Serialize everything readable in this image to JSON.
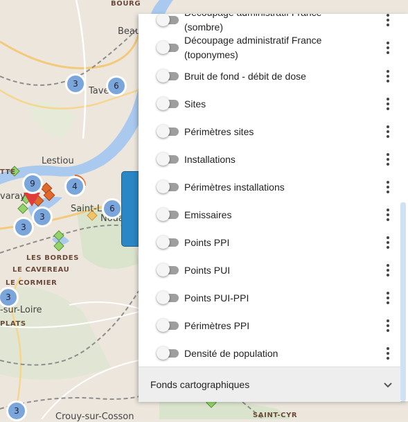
{
  "map": {
    "labels": [
      {
        "id": "bourg",
        "text": "BOURG",
        "cls": "caps"
      },
      {
        "id": "beau",
        "text": "Beau",
        "cls": "town"
      },
      {
        "id": "tave",
        "text": "Tave",
        "cls": "town"
      },
      {
        "id": "lestiou",
        "text": "Lestiou",
        "cls": "town"
      },
      {
        "id": "varay",
        "text": "varay",
        "cls": "town"
      },
      {
        "id": "tte",
        "text": "TTE",
        "cls": "caps"
      },
      {
        "id": "saint-l",
        "text": "Saint-L",
        "cls": "town"
      },
      {
        "id": "nouan",
        "text": "Nouan",
        "cls": "town"
      },
      {
        "id": "les-bordes",
        "text": "LES BORDES",
        "cls": "caps"
      },
      {
        "id": "le-cavereau",
        "text": "LE CAVEREAU",
        "cls": "caps"
      },
      {
        "id": "le-cormier",
        "text": "LE CORMIER",
        "cls": "caps"
      },
      {
        "id": "sur-loire",
        "text": "-sur-Loire",
        "cls": "town"
      },
      {
        "id": "plats",
        "text": "PLATS",
        "cls": "caps"
      },
      {
        "id": "crouy",
        "text": "Crouy-sur-Cosson",
        "cls": "town"
      },
      {
        "id": "saint-cyr",
        "text": "SAINT-CYR",
        "cls": "caps"
      }
    ],
    "clusters": [
      {
        "id": "c1",
        "count": "3"
      },
      {
        "id": "c2",
        "count": "6"
      },
      {
        "id": "c3",
        "count": "9"
      },
      {
        "id": "c4",
        "count": "4"
      },
      {
        "id": "c5",
        "count": "6"
      },
      {
        "id": "c6",
        "count": "3"
      },
      {
        "id": "c7",
        "count": "3"
      },
      {
        "id": "c8",
        "count": "3"
      },
      {
        "id": "c9",
        "count": "3"
      }
    ]
  },
  "layers_panel": {
    "layers": [
      {
        "label": "Découpage administratif France (sombre)",
        "enabled": false
      },
      {
        "label": "Découpage administratif France (toponymes)",
        "enabled": false
      },
      {
        "label": "Bruit de fond - débit de dose",
        "enabled": false
      },
      {
        "label": "Sites",
        "enabled": false
      },
      {
        "label": "Périmètres sites",
        "enabled": false
      },
      {
        "label": "Installations",
        "enabled": false
      },
      {
        "label": "Périmètres installations",
        "enabled": false
      },
      {
        "label": "Emissaires",
        "enabled": false
      },
      {
        "label": "Points PPI",
        "enabled": false
      },
      {
        "label": "Points PUI",
        "enabled": false
      },
      {
        "label": "Points PUI-PPI",
        "enabled": false
      },
      {
        "label": "Périmètres PPI",
        "enabled": false
      },
      {
        "label": "Densité de population",
        "enabled": false
      }
    ],
    "footer": {
      "label": "Fonds cartographiques",
      "icon": "chevron-down-icon"
    }
  },
  "colors": {
    "toggle_off_track": "#9e9e9e",
    "cluster_fill": "#7aa6dc",
    "river": "#a9c9ee",
    "side_tab": "#2a86c4"
  }
}
